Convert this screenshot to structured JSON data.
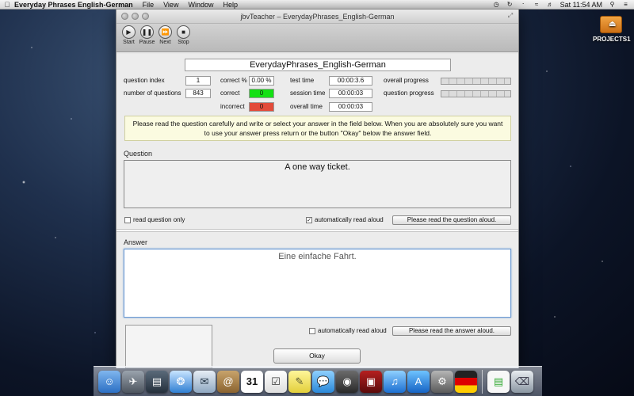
{
  "menubar": {
    "apple_symbol": "",
    "app_name": "Everyday Phrases English-German",
    "menus": [
      "File",
      "View",
      "Window",
      "Help"
    ],
    "clock": "Sat 11:54 AM",
    "status_icons": [
      "time-machine-icon",
      "sync-icon",
      "bluetooth-icon",
      "wifi-icon",
      "volume-icon",
      "spotlight-icon",
      "list-icon"
    ]
  },
  "desktop": {
    "drive_label": "PROJECTS1"
  },
  "window": {
    "title": "jbvTeacher – EverydayPhrases_English-German",
    "toolbar": {
      "start": "Start",
      "pause": "Pause",
      "next": "Next",
      "stop": "Stop"
    },
    "course_title": "EverydayPhrases_English-German",
    "stats": {
      "question_index_label": "question index",
      "question_index": "1",
      "number_of_questions_label": "number of questions",
      "number_of_questions": "843",
      "correct_percent_label": "correct %",
      "correct_percent": "0.00 %",
      "correct_label": "correct",
      "correct": "0",
      "incorrect_label": "incorrect",
      "incorrect": "0",
      "test_time_label": "test time",
      "test_time": "00:00:3.6",
      "session_time_label": "session time",
      "session_time": "00:00:03",
      "overall_time_label": "overall time",
      "overall_time": "00:00:03",
      "overall_progress_label": "overall progress",
      "question_progress_label": "question progress"
    },
    "instructions": "Please read the question carefully and write or select your answer in the field below. When you are absolutely sure you want to use your answer press return or the button \"Okay\" below the answer field.",
    "question_label": "Question",
    "question": "A one way ticket.",
    "read_question_only": "read question only",
    "auto_read_question": "automatically read aloud",
    "read_question_button": "Please read the question aloud.",
    "answer_label": "Answer",
    "answer": "Eine einfache Fahrt.",
    "auto_read_answer": "automatically read aloud",
    "read_answer_button": "Please read the answer aloud.",
    "okay_button": "Okay"
  },
  "dock": {
    "items": [
      "finder",
      "launchpad",
      "mission-control",
      "safari",
      "mail",
      "contacts",
      "calendar",
      "reminders",
      "notes",
      "messages",
      "facetime",
      "photo-booth",
      "itunes",
      "app-store",
      "system-preferences",
      "flag",
      "document",
      "trash"
    ]
  }
}
